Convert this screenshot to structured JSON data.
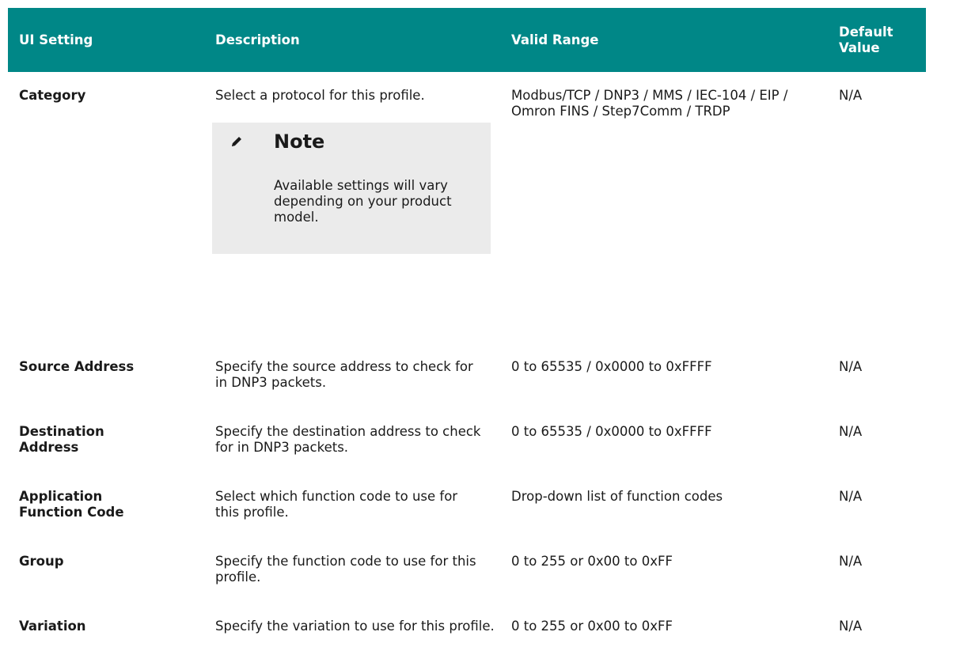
{
  "table": {
    "headers": {
      "setting": "UI Setting",
      "description": "Description",
      "range": "Valid Range",
      "default": "Default Value"
    },
    "rows": [
      {
        "setting": "Category",
        "description": "Select a protocol for this profile.",
        "range": "Modbus/TCP / DNP3 / MMS / IEC-104 / EIP / Omron FINS / Step7Comm / TRDP",
        "default": "N/A"
      },
      {
        "setting": "Source Address",
        "description": "Specify the source address to check for in DNP3 packets.",
        "range": "0 to 65535 / 0x0000 to 0xFFFF",
        "default": "N/A"
      },
      {
        "setting": "Destination Address",
        "description": "Specify the destination address to check for in DNP3 packets.",
        "range": "0 to 65535 / 0x0000 to 0xFFFF",
        "default": "N/A"
      },
      {
        "setting": "Application Function Code",
        "description": "Select which function code to use for this profile.",
        "range": "Drop-down list of function codes",
        "default": "N/A"
      },
      {
        "setting": "Group",
        "description": "Specify the function code to use for this profile.",
        "range": "0 to 255 or 0x00 to 0xFF",
        "default": "N/A"
      },
      {
        "setting": "Variation",
        "description": "Specify the variation to use for this profile.",
        "range": "0 to 255 or 0x00 to 0xFF",
        "default": "N/A"
      }
    ]
  },
  "note": {
    "icon": "pencil-icon",
    "title": "Note",
    "body": "Available settings will vary depending on your product model."
  },
  "colors": {
    "header_bg": "#008787",
    "header_text": "#ffffff",
    "note_bg": "#ebebeb"
  }
}
